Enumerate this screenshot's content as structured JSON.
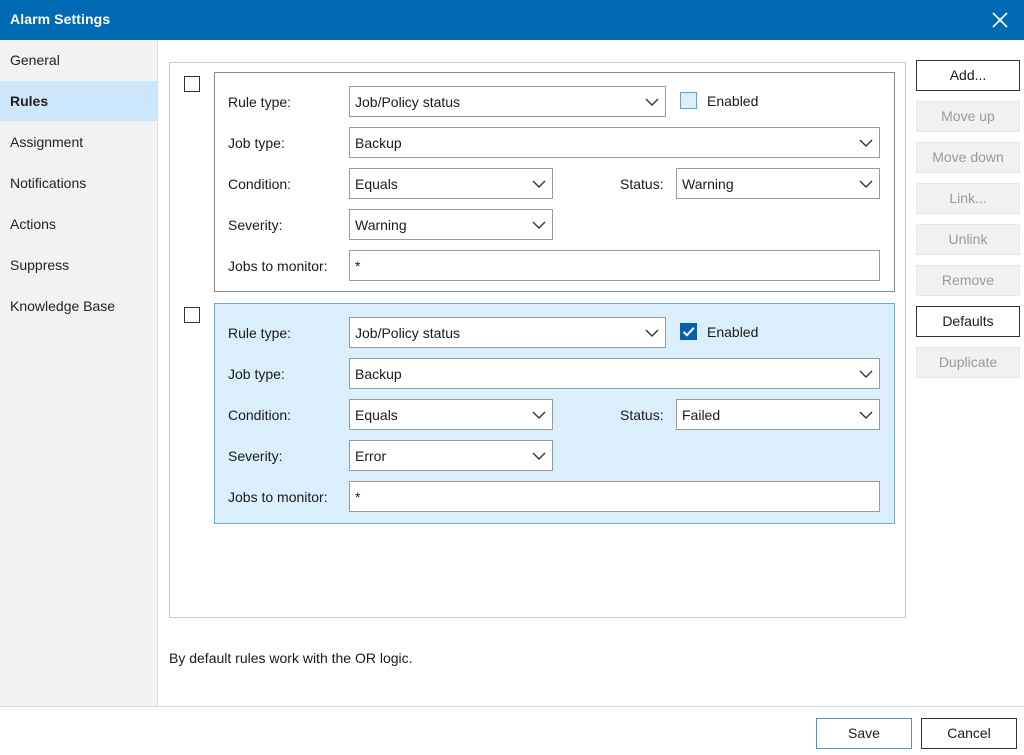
{
  "window": {
    "title": "Alarm Settings",
    "close_icon": "close-icon"
  },
  "sidebar": {
    "items": [
      {
        "label": "General"
      },
      {
        "label": "Rules",
        "active": true
      },
      {
        "label": "Assignment"
      },
      {
        "label": "Notifications"
      },
      {
        "label": "Actions"
      },
      {
        "label": "Suppress"
      },
      {
        "label": "Knowledge Base"
      }
    ]
  },
  "labels": {
    "rule_type": "Rule type:",
    "job_type": "Job type:",
    "condition": "Condition:",
    "status": "Status:",
    "severity": "Severity:",
    "jobs_to_monitor": "Jobs to monitor:",
    "enabled": "Enabled"
  },
  "rules": [
    {
      "selected": false,
      "checked": false,
      "rule_type": "Job/Policy status",
      "enabled": false,
      "job_type": "Backup",
      "condition": "Equals",
      "status": "Warning",
      "severity": "Warning",
      "jobs_to_monitor": "*"
    },
    {
      "selected": true,
      "checked": false,
      "rule_type": "Job/Policy status",
      "enabled": true,
      "job_type": "Backup",
      "condition": "Equals",
      "status": "Failed",
      "severity": "Error",
      "jobs_to_monitor": "*"
    }
  ],
  "buttons": {
    "add": "Add...",
    "move_up": "Move up",
    "move_down": "Move down",
    "link": "Link...",
    "unlink": "Unlink",
    "remove": "Remove",
    "defaults": "Defaults",
    "duplicate": "Duplicate"
  },
  "note": "By default rules work with the OR logic.",
  "footer": {
    "save": "Save",
    "cancel": "Cancel"
  },
  "colors": {
    "titlebar": "#0069b4",
    "selection": "#cce6fb",
    "selected_rule": "#dbeefc",
    "checkbox_on": "#0a5ea8"
  }
}
